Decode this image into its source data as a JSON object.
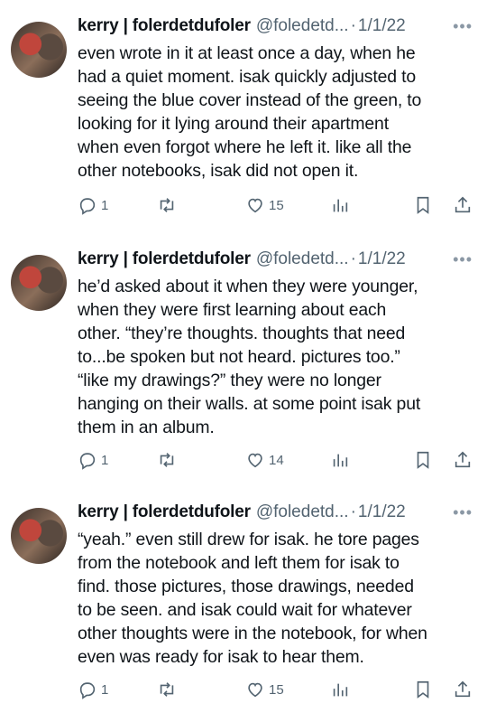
{
  "tweets": [
    {
      "author": {
        "display_name": "kerry | folerdetdufoler",
        "handle": "@foledetd...",
        "date": "1/1/22"
      },
      "lines": [
        "even wrote in it at least once a day, when he",
        "had a quiet moment. isak quickly adjusted to",
        "seeing the blue cover instead of the green, to",
        "looking for it lying around their apartment",
        "when even forgot where he left it. like all the",
        "other notebooks, isak did not open it."
      ],
      "stats": {
        "replies": "1",
        "retweets": "",
        "likes": "15"
      }
    },
    {
      "author": {
        "display_name": "kerry | folerdetdufoler",
        "handle": "@foledetd...",
        "date": "1/1/22"
      },
      "lines": [
        "he’d asked about it when they were younger,",
        "when they were first learning about each",
        "other. “they’re thoughts. thoughts that need",
        "to...be spoken but not heard. pictures too.”",
        "“like my drawings?” they were no longer",
        "hanging on their walls. at some point isak put",
        "them in an album."
      ],
      "stats": {
        "replies": "1",
        "retweets": "",
        "likes": "14"
      }
    },
    {
      "author": {
        "display_name": "kerry | folerdetdufoler",
        "handle": "@foledetd...",
        "date": "1/1/22"
      },
      "lines": [
        "“yeah.” even still drew for isak. he tore pages",
        "from the notebook and left them for isak to",
        "find. those pictures, those drawings, needed",
        "to be seen. and isak could wait for whatever",
        "other thoughts were in the notebook, for when",
        "even was ready for isak to hear them."
      ],
      "stats": {
        "replies": "1",
        "retweets": "",
        "likes": "15"
      }
    }
  ],
  "ui": {
    "dot": "·",
    "more": "•••"
  },
  "icons": [
    "reply-icon",
    "retweet-icon",
    "like-icon",
    "views-icon",
    "bookmark-icon",
    "share-icon"
  ]
}
